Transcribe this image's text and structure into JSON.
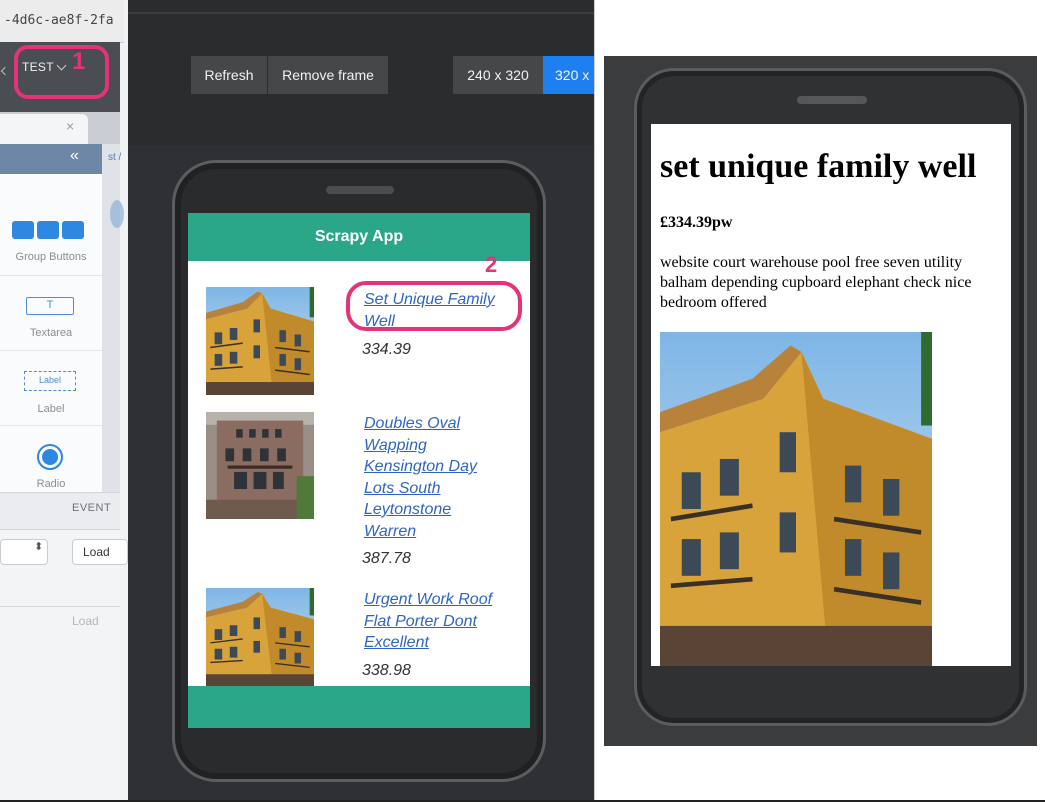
{
  "ide": {
    "url_fragment": "-4d6c-ae8f-2fa",
    "environment": "TEST",
    "tab_close": "×",
    "collapse_icon": "«",
    "stub_text": "st /",
    "palette": [
      {
        "label": "Group Buttons",
        "icon": "group-buttons-icon"
      },
      {
        "label": "Textarea",
        "icon": "textarea-icon",
        "glyph": "T"
      },
      {
        "label": "Label",
        "icon": "label-icon",
        "glyph": "Label"
      },
      {
        "label": "Radio",
        "icon": "radio-icon"
      }
    ],
    "events_header": "EVENT",
    "select_arrow": "⬍",
    "event_value": "Load",
    "event_disabled": "Load"
  },
  "preview": {
    "refresh": "Refresh",
    "remove_frame": "Remove frame",
    "size_240": "240 x 320",
    "size_320": "320 x",
    "app_title": "Scrapy App",
    "items": [
      {
        "title": "Set Unique Family Well",
        "price": "334.39"
      },
      {
        "title": "Doubles Oval Wapping Kensington Day Lots South Leytonstone Warren",
        "price": "387.78"
      },
      {
        "title": "Urgent Work Roof Flat Porter Dont Excellent",
        "price": "338.98"
      }
    ]
  },
  "detail": {
    "title": "set unique family well",
    "price": "£334.39pw",
    "description": "website court warehouse pool free seven utility balham depending cupboard elephant check nice bedroom offered"
  },
  "callouts": {
    "one": "1",
    "two": "2"
  },
  "colors": {
    "accent_pink": "#e4337a",
    "app_green": "#2aa689",
    "link_blue": "#2f65c2",
    "active_blue": "#1e7ff0"
  }
}
